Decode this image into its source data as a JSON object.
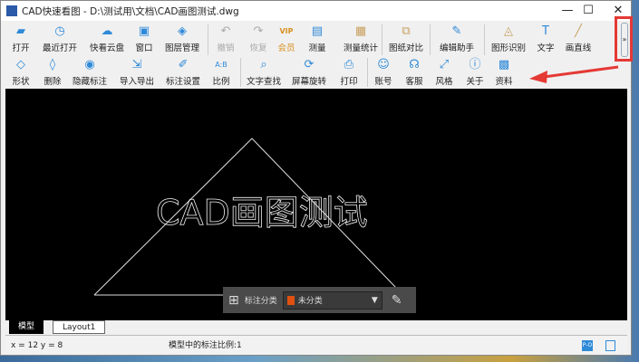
{
  "window": {
    "title": "CAD快速看图 - D:\\测试用\\文档\\CAD画图测试.dwg",
    "logo": "看图",
    "minimize": "—",
    "maximize": "☐",
    "close": "✕"
  },
  "toolbar": {
    "row1": [
      {
        "label": "打开",
        "icon": "folder-open-icon",
        "glyph": "▰"
      },
      {
        "label": "最近打开",
        "icon": "clock-icon",
        "glyph": "◷"
      },
      {
        "label": "快看云盘",
        "icon": "cloud-icon",
        "glyph": "☁"
      },
      {
        "label": "窗口",
        "icon": "window-icon",
        "glyph": "▣"
      },
      {
        "label": "图层管理",
        "icon": "layers-icon",
        "glyph": "◈"
      },
      {
        "label": "撤销",
        "icon": "undo-icon",
        "glyph": "↶",
        "disabled": true
      },
      {
        "label": "恢复",
        "icon": "redo-icon",
        "glyph": "↷",
        "disabled": true
      },
      {
        "label": "会员",
        "icon": "vip-icon",
        "glyph": "VIP"
      },
      {
        "label": "测量",
        "icon": "ruler-icon",
        "glyph": "▤"
      },
      {
        "label": "测量统计",
        "icon": "measure-stats-icon",
        "glyph": "▦"
      },
      {
        "label": "图纸对比",
        "icon": "compare-icon",
        "glyph": "⧉"
      },
      {
        "label": "编辑助手",
        "icon": "edit-assistant-icon",
        "glyph": "✎"
      },
      {
        "label": "图形识别",
        "icon": "shape-recognition-icon",
        "glyph": "◬"
      },
      {
        "label": "文字",
        "icon": "text-icon",
        "glyph": "T"
      },
      {
        "label": "画直线",
        "icon": "line-icon",
        "glyph": "╱"
      }
    ],
    "row2": [
      {
        "label": "形状",
        "icon": "shape-icon",
        "glyph": "◇"
      },
      {
        "label": "删除",
        "icon": "eraser-icon",
        "glyph": "◊"
      },
      {
        "label": "隐藏标注",
        "icon": "eye-hidden-icon",
        "glyph": "◉"
      },
      {
        "label": "导入导出",
        "icon": "import-export-icon",
        "glyph": "⇲"
      },
      {
        "label": "标注设置",
        "icon": "annotation-settings-icon",
        "glyph": "✐"
      },
      {
        "label": "比例",
        "icon": "scale-icon",
        "glyph": "A:B"
      },
      {
        "label": "文字查找",
        "icon": "text-search-icon",
        "glyph": "⌕"
      },
      {
        "label": "屏幕旋转",
        "icon": "rotate-screen-icon",
        "glyph": "⟳"
      },
      {
        "label": "打印",
        "icon": "printer-icon",
        "glyph": "⎙"
      },
      {
        "label": "账号",
        "icon": "user-icon",
        "glyph": "☺"
      },
      {
        "label": "客服",
        "icon": "headset-icon",
        "glyph": "☊"
      },
      {
        "label": "风格",
        "icon": "style-icon",
        "glyph": "⤢"
      },
      {
        "label": "关于",
        "icon": "info-icon",
        "glyph": "ⓘ"
      },
      {
        "label": "资料",
        "icon": "docs-icon",
        "glyph": "▩"
      }
    ],
    "more": "»"
  },
  "drawing": {
    "text": "CAD画图测试"
  },
  "annotation_bar": {
    "label": "标注分类",
    "selected": "未分类",
    "swatch": "#e05010"
  },
  "tabs": [
    "模型",
    "Layout1"
  ],
  "status": {
    "coords": "x = 12 y = 8",
    "scale": "模型中的标注比例:1"
  },
  "colors": {
    "accent": "#2f8ad8",
    "highlight": "#e53935"
  }
}
